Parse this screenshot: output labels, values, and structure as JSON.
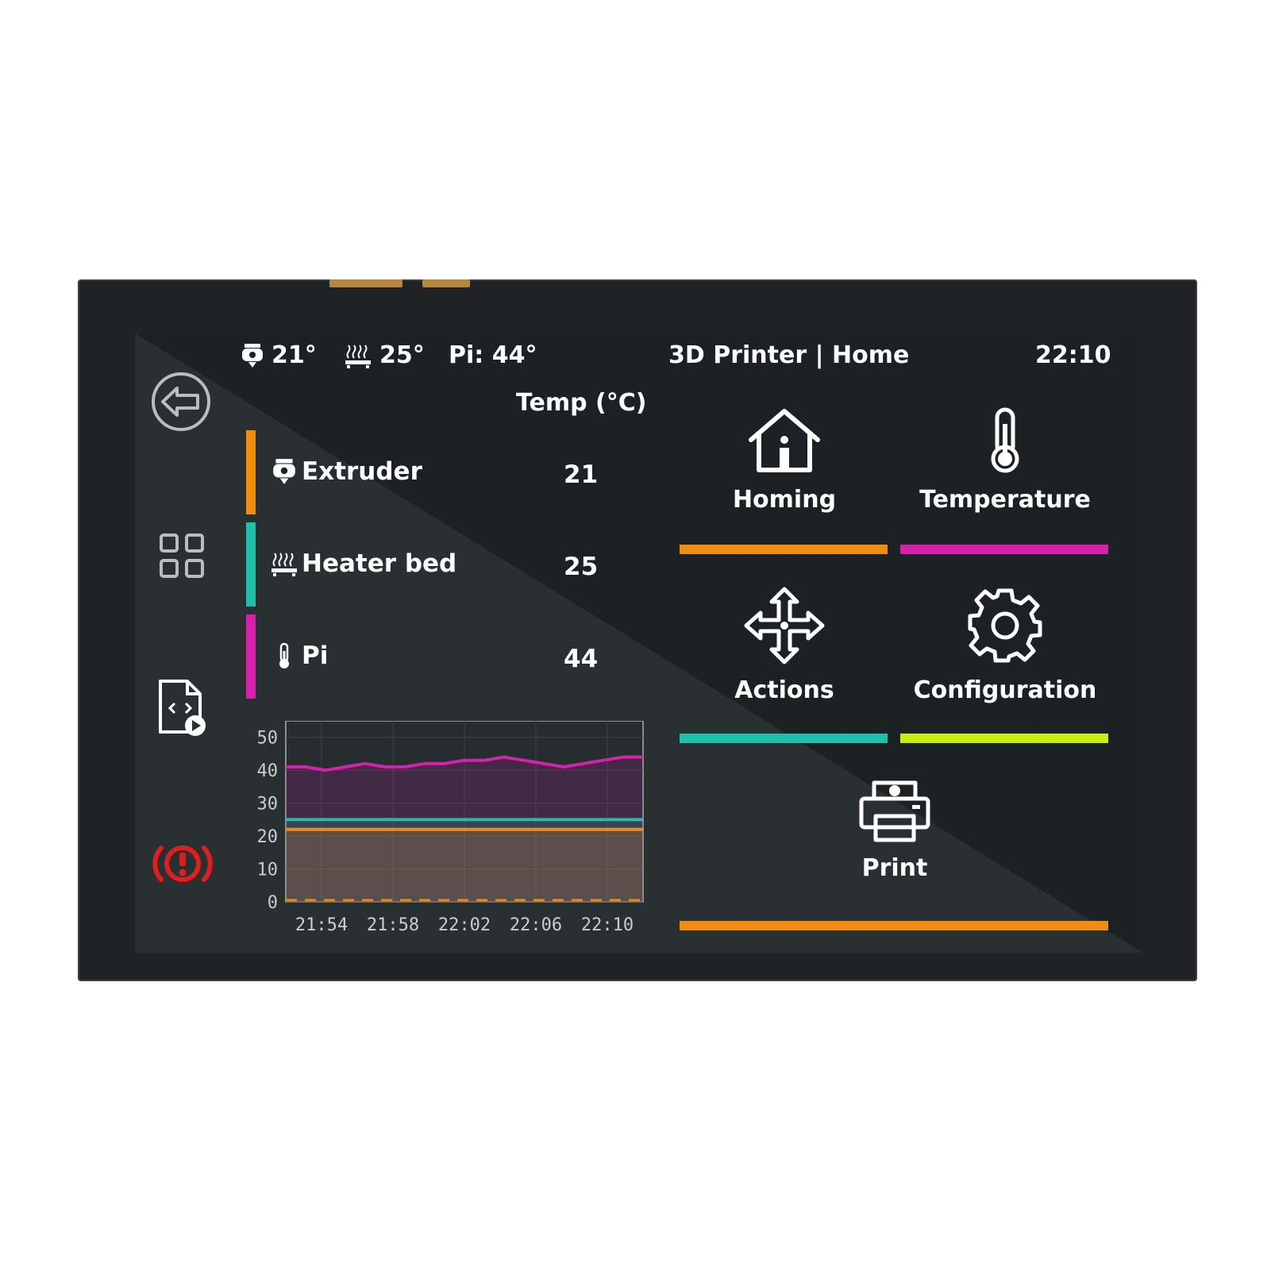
{
  "status_bar": {
    "extruder_temp": "21°",
    "bed_temp": "25°",
    "pi_temp": "Pi: 44°",
    "title": "3D Printer | Home",
    "clock": "22:10"
  },
  "sidebar": {
    "items": [
      {
        "icon": "back-arrow-icon"
      },
      {
        "icon": "grid-icon"
      },
      {
        "icon": "gcode-file-icon"
      },
      {
        "icon": "emergency-stop-icon"
      }
    ]
  },
  "temperatures": {
    "title": "Temp (°C)",
    "rows": [
      {
        "name": "Extruder",
        "value": "21",
        "color": "#f28c0f",
        "icon": "extruder-icon"
      },
      {
        "name": "Heater bed",
        "value": "25",
        "color": "#1fbfae",
        "icon": "heater-bed-icon"
      },
      {
        "name": "Pi",
        "value": "44",
        "color": "#d81fae",
        "icon": "thermometer-icon"
      }
    ]
  },
  "chart_data": {
    "type": "line",
    "title": "",
    "xlabel": "",
    "ylabel": "",
    "x_ticks": [
      "21:54",
      "21:58",
      "22:02",
      "22:06",
      "22:10"
    ],
    "y_ticks": [
      "0",
      "10",
      "20",
      "30",
      "40",
      "50"
    ],
    "ylim": [
      0,
      55
    ],
    "grid": true,
    "series": [
      {
        "color": "#d81fae",
        "values": [
          41,
          41,
          40,
          41,
          42,
          41,
          41,
          42,
          42,
          43,
          43,
          44,
          43,
          42,
          41,
          42,
          43,
          44,
          44
        ]
      },
      {
        "color": "#1fbfae",
        "values": [
          25,
          25,
          25,
          25,
          25,
          25,
          25,
          25,
          25,
          25,
          25,
          25,
          25,
          25,
          25,
          25,
          25,
          25,
          25
        ]
      },
      {
        "color": "#f28c0f",
        "values": [
          22,
          22,
          22,
          22,
          22,
          22,
          22,
          22,
          22,
          22,
          22,
          22,
          22,
          22,
          22,
          22,
          22,
          22,
          22
        ]
      }
    ]
  },
  "tiles": [
    {
      "label": "Homing",
      "icon": "home-icon",
      "color": "#f28c0f"
    },
    {
      "label": "Temperature",
      "icon": "thermometer-icon",
      "color": "#d81fae"
    },
    {
      "label": "Actions",
      "icon": "move-arrows-icon",
      "color": "#1fbfae"
    },
    {
      "label": "Configuration",
      "icon": "gear-icon",
      "color": "#c8ee12"
    },
    {
      "label": "Print",
      "icon": "printer-icon",
      "color": "#f28c0f"
    }
  ]
}
